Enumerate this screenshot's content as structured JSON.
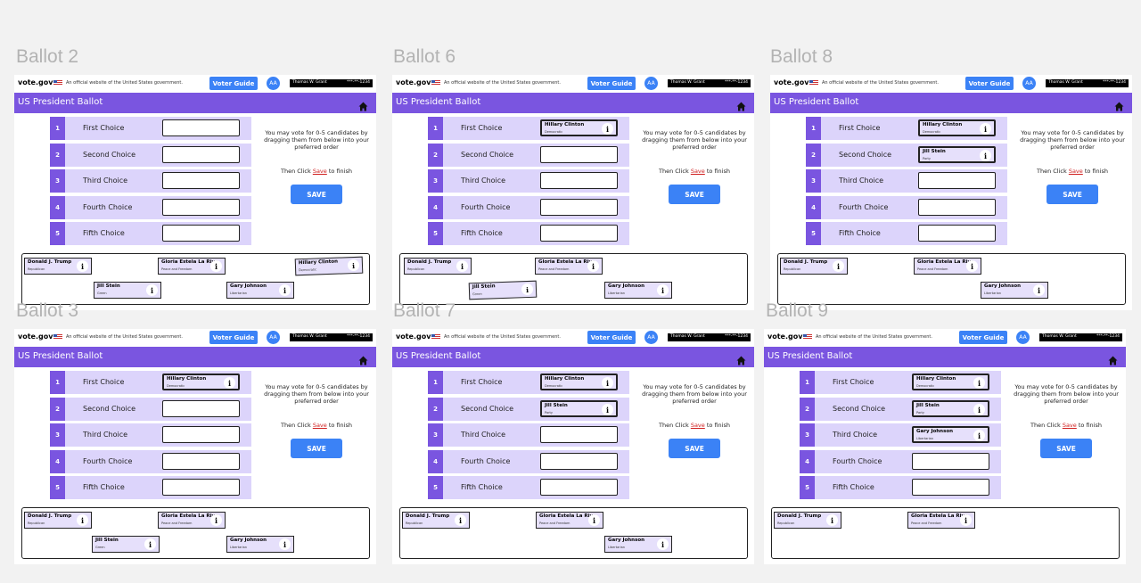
{
  "common": {
    "brand": "vote.gov",
    "official_notice": "An official website of the United States government.",
    "voter_guide_label": "Voter Guide",
    "aa_label": "AA",
    "user_name": "Thomas W. Grant",
    "user_id": "***-**-1234",
    "ballot_title": "US President Ballot",
    "choices": [
      "First Choice",
      "Second Choice",
      "Third Choice",
      "Fourth Choice",
      "Fifth Choice"
    ],
    "choice_numbers": [
      "1",
      "2",
      "3",
      "4",
      "5"
    ],
    "instruction": "You may vote for 0-5 candidates by dragging them from below into your preferred order",
    "then_prefix": "Then Click",
    "then_save": "Save",
    "then_suffix": "to finish",
    "save_label": "SAVE",
    "info_glyph": "i"
  },
  "colors": {
    "header_purple": "#7a55e0",
    "row_lavender": "#dcd4fb",
    "button_blue": "#3b82f6",
    "card_fill": "#e6e0fb"
  },
  "ballots": [
    {
      "title": "Ballot 2",
      "slots": [
        {
          "name": "",
          "party": ""
        },
        {
          "name": "",
          "party": ""
        },
        {
          "name": "",
          "party": ""
        },
        {
          "name": "",
          "party": ""
        },
        {
          "name": "",
          "party": ""
        }
      ],
      "pool": [
        {
          "name": "Donald J. Trump",
          "party": "Republican"
        },
        {
          "name": "Gloria Estela La Riva",
          "party": "Peace and Freedom"
        },
        {
          "name": "Hillary Clinton",
          "party": "Democratic"
        },
        {
          "name": "Jill Stein",
          "party": "Green"
        },
        {
          "name": "Gary Johnson",
          "party": "Libertarian"
        }
      ]
    },
    {
      "title": "Ballot 6",
      "slots": [
        {
          "name": "Hillary Clinton",
          "party": "Democratic"
        },
        {
          "name": "",
          "party": ""
        },
        {
          "name": "",
          "party": ""
        },
        {
          "name": "",
          "party": ""
        },
        {
          "name": "",
          "party": ""
        }
      ],
      "pool": [
        {
          "name": "Donald J. Trump",
          "party": "Republican"
        },
        {
          "name": "Gloria Estela La Riva",
          "party": "Peace and Freedom"
        },
        {
          "name": "Jill Stein",
          "party": "Green"
        },
        {
          "name": "Gary Johnson",
          "party": "Libertarian"
        }
      ]
    },
    {
      "title": "Ballot 8",
      "slots": [
        {
          "name": "Hillary Clinton",
          "party": "Democratic"
        },
        {
          "name": "Jill Stein",
          "party": "Party"
        },
        {
          "name": "",
          "party": ""
        },
        {
          "name": "",
          "party": ""
        },
        {
          "name": "",
          "party": ""
        }
      ],
      "pool": [
        {
          "name": "Donald J. Trump",
          "party": "Republican"
        },
        {
          "name": "Gloria Estela La Riva",
          "party": "Peace and Freedom"
        },
        {
          "name": "Gary Johnson",
          "party": "Libertarian"
        }
      ]
    },
    {
      "title": "Ballot 3",
      "slots": [
        {
          "name": "Hillary Clinton",
          "party": "Democratic"
        },
        {
          "name": "",
          "party": ""
        },
        {
          "name": "",
          "party": ""
        },
        {
          "name": "",
          "party": ""
        },
        {
          "name": "",
          "party": ""
        }
      ],
      "pool": [
        {
          "name": "Donald J. Trump",
          "party": "Republican"
        },
        {
          "name": "Gloria Estela La Riva",
          "party": "Peace and Freedom"
        },
        {
          "name": "Jill Stein",
          "party": "Green"
        },
        {
          "name": "Gary Johnson",
          "party": "Libertarian"
        }
      ]
    },
    {
      "title": "Ballot 7",
      "slots": [
        {
          "name": "Hillary Clinton",
          "party": "Democratic"
        },
        {
          "name": "Jill Stein",
          "party": "Party"
        },
        {
          "name": "",
          "party": ""
        },
        {
          "name": "",
          "party": ""
        },
        {
          "name": "",
          "party": ""
        }
      ],
      "pool": [
        {
          "name": "Donald J. Trump",
          "party": "Republican"
        },
        {
          "name": "Gloria Estela La Riva",
          "party": "Peace and Freedom"
        },
        {
          "name": "Gary Johnson",
          "party": "Libertarian"
        }
      ]
    },
    {
      "title": "Ballot 9",
      "slots": [
        {
          "name": "Hillary Clinton",
          "party": "Democratic"
        },
        {
          "name": "Jill Stein",
          "party": "Party"
        },
        {
          "name": "Gary Johnson",
          "party": "Libertarian"
        },
        {
          "name": "",
          "party": ""
        },
        {
          "name": "",
          "party": ""
        }
      ],
      "pool": [
        {
          "name": "Donald J. Trump",
          "party": "Republican"
        },
        {
          "name": "Gloria Estela La Riva",
          "party": "Peace and Freedom"
        }
      ]
    }
  ]
}
